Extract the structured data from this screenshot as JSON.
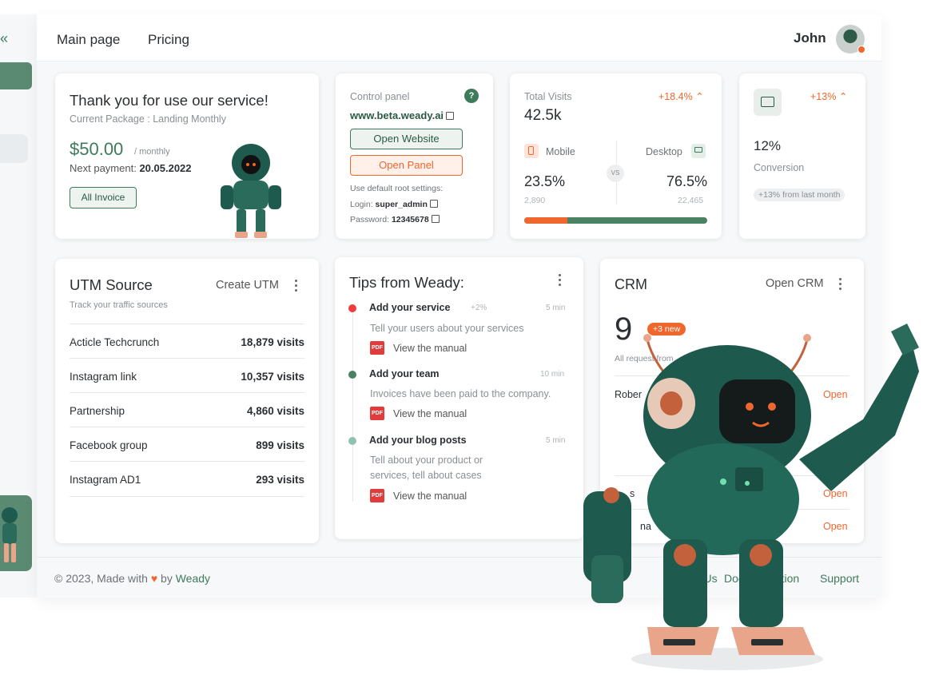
{
  "nav": {
    "links": [
      "Main page",
      "Pricing"
    ],
    "user_name": "John"
  },
  "thanks": {
    "title": "Thank you for use our service!",
    "package": "Current Package : Landing Monthly",
    "price": "$50.00",
    "period": "/ monthly",
    "next_payment_label": "Next payment:",
    "next_payment_date": "20.05.2022",
    "invoice_button": "All Invoice"
  },
  "control": {
    "title": "Control panel",
    "help": "?",
    "domain": "www.beta.weady.ai",
    "open_website": "Open Website",
    "open_panel": "Open Panel",
    "settings_note": "Use  default root settings:",
    "login_label": "Login:",
    "login_value": "super_admin",
    "password_label": "Password:",
    "password_value": "12345678"
  },
  "visits": {
    "title": "Total Visits",
    "change": "+18.4%",
    "total": "42.5k",
    "mobile_label": "Mobile",
    "desktop_label": "Desktop",
    "vs": "VS",
    "mobile_pct": "23.5%",
    "desktop_pct": "76.5%",
    "mobile_count": "2,890",
    "desktop_count": "22,465",
    "mobile_share": 0.235,
    "colors": {
      "mobile": "#f0672e",
      "desktop": "#4a8264"
    }
  },
  "conversion": {
    "change": "+13%",
    "value": "12%",
    "label": "Conversion",
    "note": "+13% from last month"
  },
  "utm": {
    "title": "UTM Source",
    "action": "Create UTM",
    "subtitle": "Track your traffic sources",
    "rows": [
      {
        "source": "Acticle Techcrunch",
        "visits": "18,879 visits"
      },
      {
        "source": "Instagram link",
        "visits": "10,357 visits"
      },
      {
        "source": "Partnership",
        "visits": "4,860 visits"
      },
      {
        "source": "Facebook group",
        "visits": "899 visits"
      },
      {
        "source": "Instagram AD1",
        "visits": "293 visits"
      }
    ]
  },
  "tips": {
    "title": "Tips from Weady:",
    "manual_label": "View the manual",
    "pdf": "PDF",
    "items": [
      {
        "title": "Add your service",
        "badge": "+2%",
        "time": "5 min",
        "desc": "Tell your users about your services",
        "color": "#f03c3c"
      },
      {
        "title": "Add your team",
        "badge": "",
        "time": "10 min",
        "desc": "Invoices have been paid to the company.",
        "color": "#4a8264"
      },
      {
        "title": "Add your blog posts",
        "badge": "",
        "time": "5 min",
        "desc": "Tell about your product or services, tell about cases",
        "desc1": "Tell about your product or",
        "desc2": "services, tell about cases",
        "color": "#8fc3b0"
      }
    ]
  },
  "crm": {
    "title": "CRM",
    "action": "Open CRM",
    "count": "9",
    "badge": "+3 new",
    "subtitle": "All request from",
    "rows": [
      {
        "name": "Rober",
        "action": "Open"
      },
      {
        "name": "s",
        "action": "Open"
      },
      {
        "name": "na",
        "action": "Open"
      }
    ]
  },
  "footer": {
    "copyright": "© 2023, Made with",
    "by": "by",
    "brand": "Weady",
    "links": [
      "About Us",
      "Documentation",
      "Support"
    ]
  }
}
